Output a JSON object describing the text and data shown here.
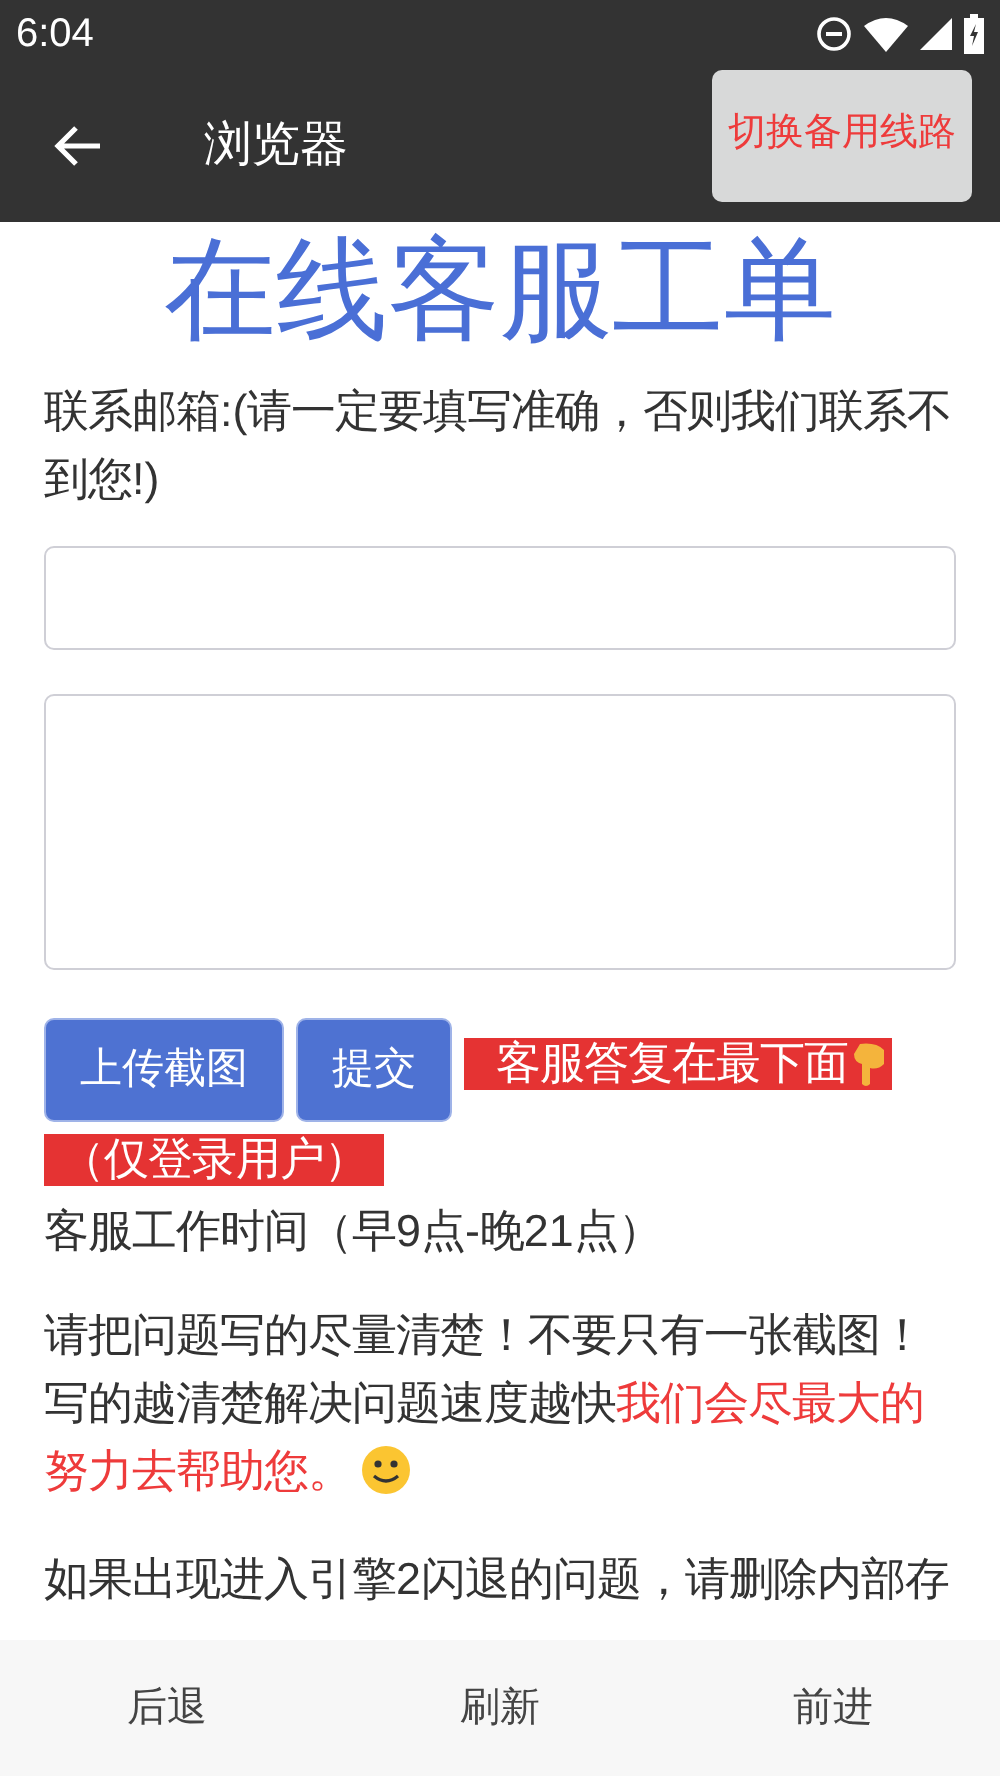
{
  "status_bar": {
    "time": "6:04"
  },
  "toolbar": {
    "title": "浏览器",
    "switch_button": "切换备用线路"
  },
  "page": {
    "heading": "在线客服工单",
    "email_label": "联系邮箱:(请一定要填写准确，否则我们联系不到您!)",
    "buttons": [
      "上传截图",
      "提交"
    ],
    "notices": [
      "客服答复在最下面",
      "（仅登录用户）"
    ],
    "hours": "客服工作时间（早9点-晚21点）",
    "paragraph_1": [
      {
        "text": "请把问题写的尽量清楚！不要只有一张截图！写的越清楚解决问题速度越快",
        "highlight": false
      },
      {
        "text": "我们会尽最大的努力去帮助您。",
        "highlight": true
      }
    ],
    "paragraph_2": "如果出现进入引擎2闪退的问题，请删除内部存"
  },
  "bottom_nav": [
    "后退",
    "刷新",
    "前进"
  ]
}
